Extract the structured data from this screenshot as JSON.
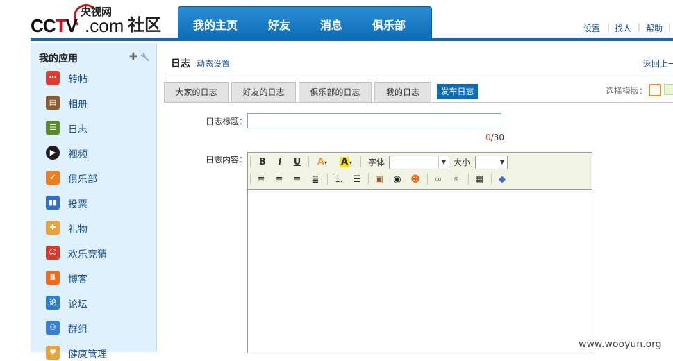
{
  "header": {
    "logo_brand_cn": "央视网",
    "logo_cctv": "CCTV",
    "logo_com": ".com",
    "logo_community": "社区",
    "nav": [
      "我的主页",
      "好友",
      "消息",
      "俱乐部"
    ],
    "top_links": [
      "设置",
      "找人",
      "帮助"
    ]
  },
  "sidebar": {
    "title": "我的应用",
    "tools_icons": [
      "plus-icon",
      "wrench-icon"
    ],
    "items": [
      {
        "label": "转帖",
        "icon": "share-icon",
        "color": "#e03a2f"
      },
      {
        "label": "相册",
        "icon": "album-icon",
        "color": "#8a5a2b"
      },
      {
        "label": "日志",
        "icon": "journal-icon",
        "color": "#5a8a2b"
      },
      {
        "label": "视频",
        "icon": "video-icon",
        "color": "#1e1e1e"
      },
      {
        "label": "俱乐部",
        "icon": "club-icon",
        "color": "#f07d1a"
      },
      {
        "label": "投票",
        "icon": "vote-icon",
        "color": "#2f6fd0"
      },
      {
        "label": "礼物",
        "icon": "gift-icon",
        "color": "#e8a33a"
      },
      {
        "label": "欢乐竞猜",
        "icon": "guess-icon",
        "color": "#d83a2a"
      },
      {
        "label": "博客",
        "icon": "blog-icon",
        "color": "#f06a1a"
      },
      {
        "label": "论坛",
        "icon": "forum-icon",
        "color": "#2c7ed0"
      },
      {
        "label": "群组",
        "icon": "group-icon",
        "color": "#3a7fd0"
      },
      {
        "label": "健康管理",
        "icon": "health-icon",
        "color": "#e8a33a"
      }
    ]
  },
  "main": {
    "title": "日志",
    "settings_link": "动态设置",
    "back_link": "返回上一",
    "tabs": [
      "大家的日志",
      "好友的日志",
      "俱乐部的日志",
      "我的日志"
    ],
    "publish_button": "发布日志",
    "template_label": "选择模版：",
    "form": {
      "title_label": "日志标题：",
      "title_value": "",
      "counter_current": "0",
      "counter_max": "/30",
      "content_label": "日志内容："
    },
    "editor": {
      "font_label": "字体",
      "size_label": "大小",
      "font_value": "",
      "size_value": ""
    }
  },
  "watermark": "www.wooyun.org"
}
